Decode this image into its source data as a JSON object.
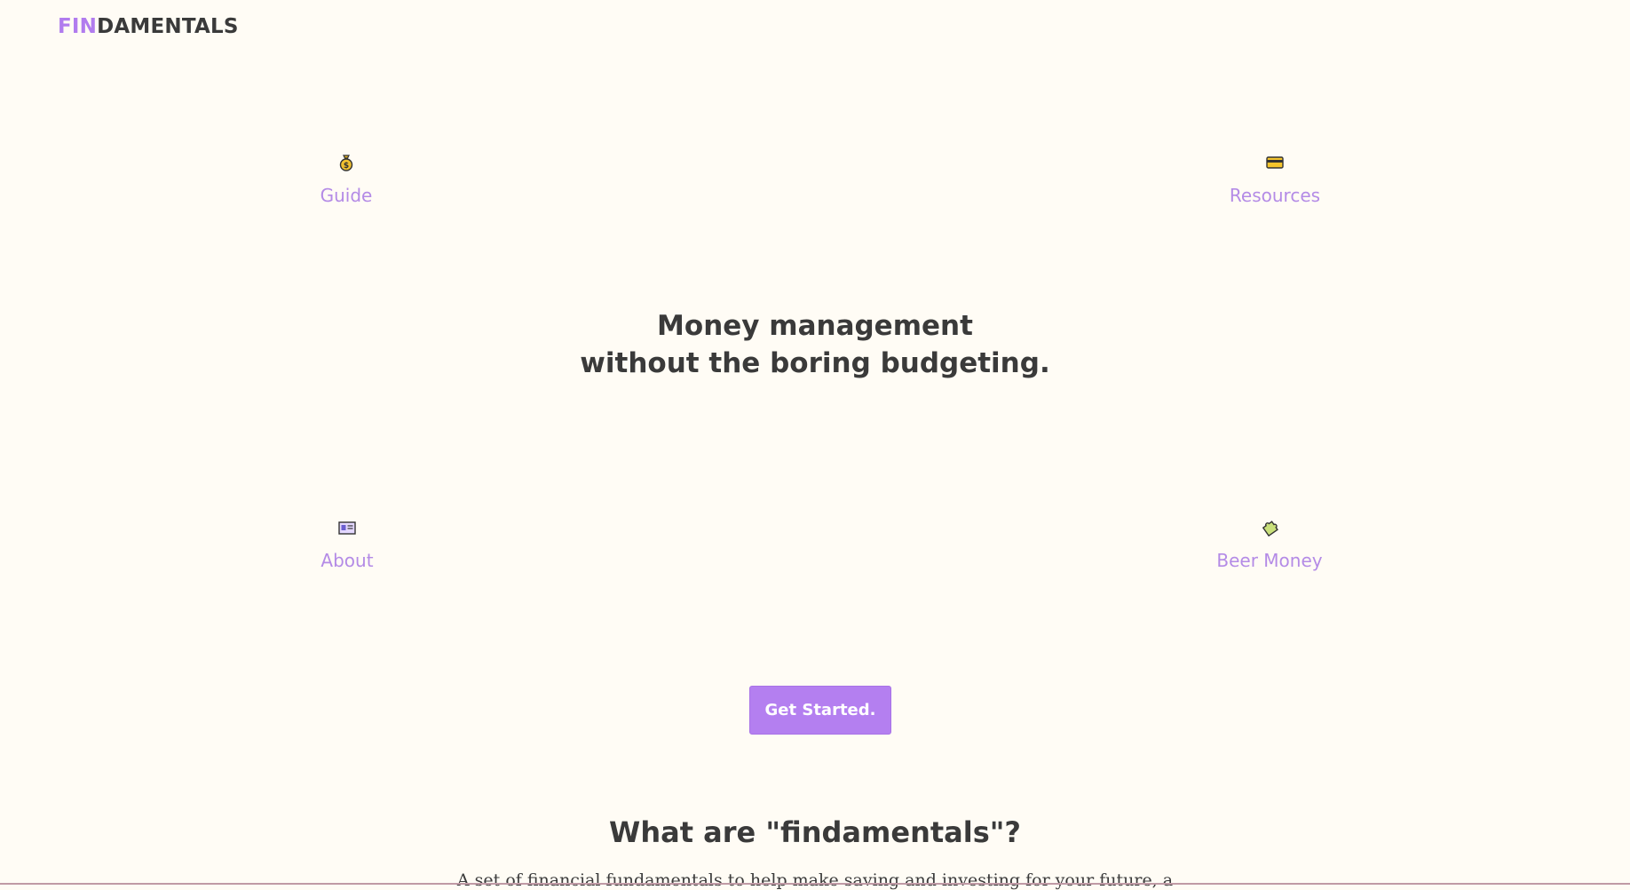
{
  "brand": {
    "logo_accent": "FIN",
    "logo_rest": "DAMENTALS",
    "accent_color": "#b17cee"
  },
  "nav": {
    "guide": {
      "label": "Guide",
      "icon": "money-bag-icon"
    },
    "resources": {
      "label": "Resources",
      "icon": "credit-card-icon"
    },
    "about": {
      "label": "About",
      "icon": "id-card-icon"
    },
    "beer_money": {
      "label": "Beer Money",
      "icon": "puzzle-piece-icon"
    }
  },
  "hero": {
    "line1": "Money management",
    "line2": "without the boring budgeting."
  },
  "cta": {
    "label": "Get Started."
  },
  "section": {
    "title": "What are \"findamentals\"?",
    "text": "A set of financial fundamentals to help make saving and investing for your future, a"
  }
}
